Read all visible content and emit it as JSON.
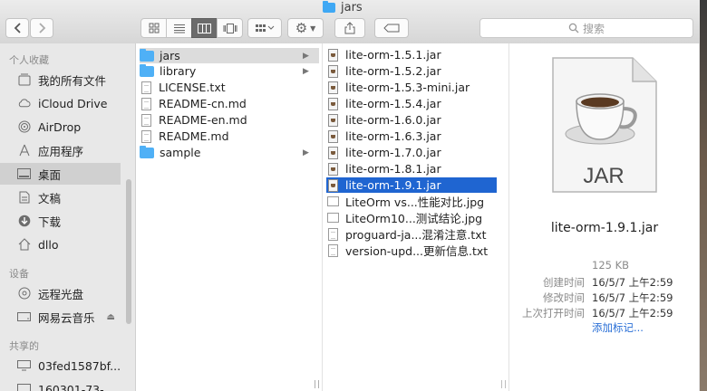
{
  "window": {
    "title": "jars"
  },
  "toolbar": {
    "search_placeholder": "搜索"
  },
  "sidebar": {
    "sections": [
      {
        "heading": "个人收藏",
        "items": [
          {
            "label": "我的所有文件",
            "icon": "all-files-icon"
          },
          {
            "label": "iCloud Drive",
            "icon": "cloud-icon"
          },
          {
            "label": "AirDrop",
            "icon": "airdrop-icon"
          },
          {
            "label": "应用程序",
            "icon": "applications-icon"
          },
          {
            "label": "桌面",
            "icon": "desktop-icon",
            "active": true
          },
          {
            "label": "文稿",
            "icon": "documents-icon"
          },
          {
            "label": "下载",
            "icon": "downloads-icon"
          },
          {
            "label": "dllo",
            "icon": "home-icon"
          }
        ]
      },
      {
        "heading": "设备",
        "items": [
          {
            "label": "远程光盘",
            "icon": "disc-icon"
          },
          {
            "label": "网易云音乐",
            "icon": "drive-icon",
            "eject": true
          }
        ]
      },
      {
        "heading": "共享的",
        "items": [
          {
            "label": "03fed1587bf...",
            "icon": "computer-icon"
          },
          {
            "label": "160301-73-...",
            "icon": "computer-icon"
          }
        ]
      }
    ]
  },
  "column1": [
    {
      "name": "jars",
      "kind": "folder",
      "arrow": true,
      "highlight": true
    },
    {
      "name": "library",
      "kind": "folder",
      "arrow": true
    },
    {
      "name": "LICENSE.txt",
      "kind": "doc"
    },
    {
      "name": "README-cn.md",
      "kind": "doc"
    },
    {
      "name": "README-en.md",
      "kind": "doc"
    },
    {
      "name": "README.md",
      "kind": "doc"
    },
    {
      "name": "sample",
      "kind": "folder",
      "arrow": true
    }
  ],
  "column2": [
    {
      "name": "lite-orm-1.5.1.jar",
      "kind": "jar"
    },
    {
      "name": "lite-orm-1.5.2.jar",
      "kind": "jar"
    },
    {
      "name": "lite-orm-1.5.3-mini.jar",
      "kind": "jar"
    },
    {
      "name": "lite-orm-1.5.4.jar",
      "kind": "jar"
    },
    {
      "name": "lite-orm-1.6.0.jar",
      "kind": "jar"
    },
    {
      "name": "lite-orm-1.6.3.jar",
      "kind": "jar"
    },
    {
      "name": "lite-orm-1.7.0.jar",
      "kind": "jar"
    },
    {
      "name": "lite-orm-1.8.1.jar",
      "kind": "jar"
    },
    {
      "name": "lite-orm-1.9.1.jar",
      "kind": "jar",
      "selected": true
    },
    {
      "name": "LiteOrm vs...性能对比.jpg",
      "kind": "img"
    },
    {
      "name": "LiteOrm10...测试结论.jpg",
      "kind": "img"
    },
    {
      "name": "proguard-ja...混淆注意.txt",
      "kind": "doc"
    },
    {
      "name": "version-upd...更新信息.txt",
      "kind": "doc"
    }
  ],
  "preview": {
    "icon_label": "JAR",
    "filename": "lite-orm-1.9.1.jar",
    "size": "125 KB",
    "created_label": "创建时间",
    "created": "16/5/7 上午2:59",
    "modified_label": "修改时间",
    "modified": "16/5/7 上午2:59",
    "opened_label": "上次打开时间",
    "opened": "16/5/7 上午2:59",
    "add_tags": "添加标记..."
  }
}
